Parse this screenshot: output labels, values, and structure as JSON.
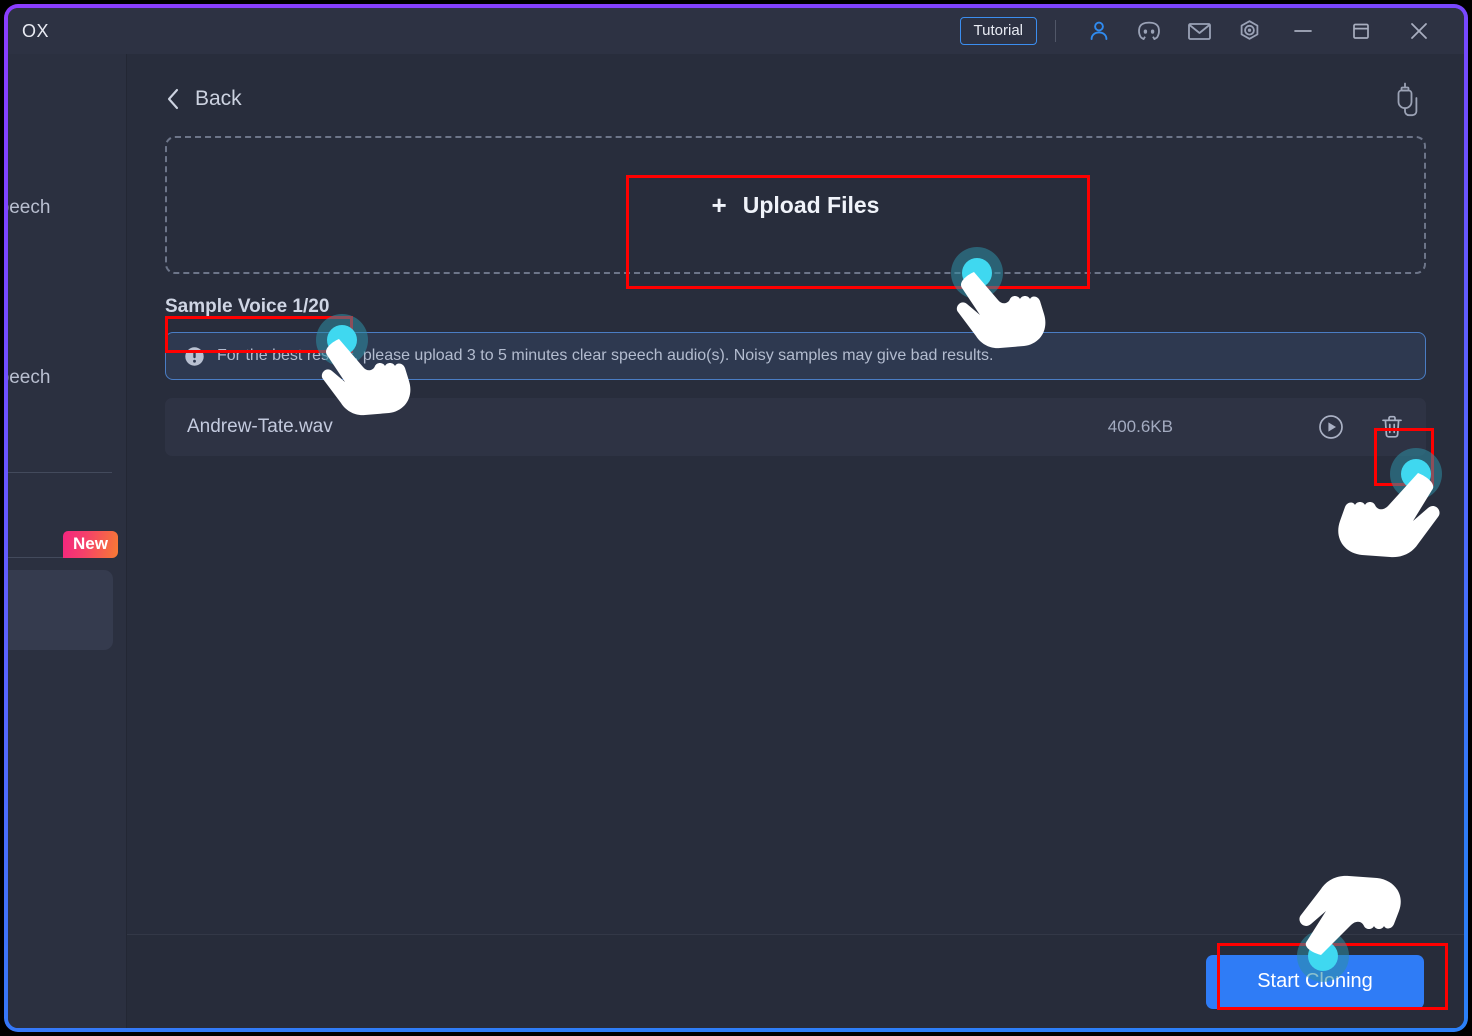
{
  "window": {
    "brand": "OX",
    "border_gradient_from": "#8b3dff",
    "border_gradient_to": "#2b80f8"
  },
  "titlebar": {
    "tutorial_label": "Tutorial",
    "icons": [
      {
        "name": "account-icon",
        "label": "Account"
      },
      {
        "name": "discord-icon",
        "label": "Discord"
      },
      {
        "name": "mail-icon",
        "label": "Mail"
      },
      {
        "name": "settings-icon",
        "label": "Settings"
      }
    ],
    "window_controls": [
      {
        "name": "minimize-button",
        "label": "Minimize"
      },
      {
        "name": "maximize-button",
        "label": "Maximize"
      },
      {
        "name": "close-button",
        "label": "Close"
      }
    ]
  },
  "sidebar": {
    "item_1_label": "Speech",
    "item_2_label": "Speech",
    "new_badge": "New"
  },
  "main": {
    "back_label": "Back",
    "record_icon_name": "voice-record-icon",
    "upload": {
      "plus": "+",
      "label": "Upload Files"
    },
    "sample_voice_heading": "Sample Voice 1/20",
    "info_banner": {
      "icon": "exclamation-circle-icon",
      "text": "For the best results, please upload 3 to 5 minutes clear speech audio(s). Noisy samples may give bad results."
    },
    "file": {
      "name": "Andrew-Tate.wav",
      "size": "400.6KB",
      "play_icon": "play-icon",
      "delete_icon": "trash-icon"
    },
    "start_cloning_label": "Start Cloning"
  },
  "annotations": {
    "box_color": "#ff0000",
    "cursor_ripple_color": "#3fd8f0",
    "boxes": [
      {
        "name": "upload-files-highlight"
      },
      {
        "name": "sample-voice-highlight"
      },
      {
        "name": "delete-file-highlight"
      },
      {
        "name": "start-cloning-highlight"
      }
    ]
  }
}
